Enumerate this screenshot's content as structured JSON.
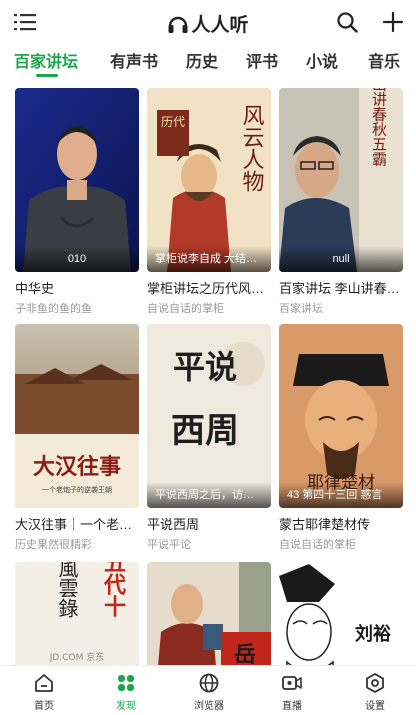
{
  "app": {
    "title": "人人听"
  },
  "tabs": [
    {
      "label": "百家讲坛",
      "active": true
    },
    {
      "label": "有声书",
      "active": false
    },
    {
      "label": "历史",
      "active": false
    },
    {
      "label": "评书",
      "active": false
    },
    {
      "label": "小说",
      "active": false
    },
    {
      "label": "音乐",
      "active": false
    }
  ],
  "cards": [
    {
      "name": "中华史",
      "author": "子非鱼的鱼的鱼",
      "caption": "010"
    },
    {
      "name": "掌柜讲坛之历代风…",
      "author": "自说自话的掌柜",
      "caption": "掌柜说李自成 大结…",
      "cover_text": [
        "历代",
        "风云人物"
      ]
    },
    {
      "name": "百家讲坛 李山讲春…",
      "author": "百家讲坛",
      "caption": "null",
      "cover_text": [
        "李山讲春秋五霸"
      ]
    },
    {
      "name": "大汉往事｜一个老…",
      "author": "历史果然很精彩",
      "cover_text": [
        "大汉往事",
        "一个老炮子的逆袭王朝"
      ]
    },
    {
      "name": "平说西周",
      "author": "平说平论",
      "caption": "平说西周之后，访…",
      "cover_text": [
        "平说",
        "西周"
      ]
    },
    {
      "name": "蒙古耶律楚材传",
      "author": "自说自话的掌柜",
      "caption": "43 第四十三回 惑言",
      "cover_text": [
        "耶律楚材"
      ]
    },
    {
      "cover_text": [
        "五代十",
        "風雲錄",
        "JD.COM 京东"
      ]
    },
    {
      "cover_text": [
        "岳"
      ]
    },
    {
      "cover_text": [
        "刘裕"
      ]
    }
  ],
  "bottom_nav": [
    {
      "label": "首页",
      "icon": "home-icon",
      "active": false
    },
    {
      "label": "发现",
      "icon": "discover-icon",
      "active": true
    },
    {
      "label": "浏览器",
      "icon": "browser-icon",
      "active": false
    },
    {
      "label": "直播",
      "icon": "live-icon",
      "active": false
    },
    {
      "label": "设置",
      "icon": "settings-icon",
      "active": false
    }
  ],
  "colors": {
    "accent": "#1aa64a",
    "text": "#222222",
    "subtext": "#9a9a9a"
  }
}
